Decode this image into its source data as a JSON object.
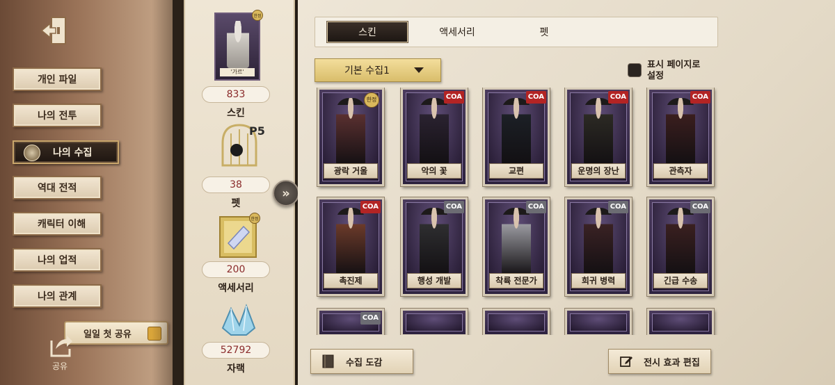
{
  "nav": {
    "items": [
      {
        "label": "개인 파일"
      },
      {
        "label": "나의 전투"
      },
      {
        "label": "나의 수집",
        "active": true
      },
      {
        "label": "역대 전적"
      },
      {
        "label": "캐릭터 이해"
      },
      {
        "label": "나의 업적"
      },
      {
        "label": "나의 관계"
      }
    ],
    "share_pill": "일일 첫 공유",
    "share_label": "공유"
  },
  "stats": {
    "portrait_name": "'가르'",
    "portrait_badge": "한정",
    "skin_count": "833",
    "skin_label": "스킨",
    "pet_count": "38",
    "pet_label": "펫",
    "accessory_count": "200",
    "accessory_label": "액세서리",
    "asset_count": "52792",
    "asset_label": "자랙"
  },
  "tabs": [
    {
      "label": "스킨",
      "active": true
    },
    {
      "label": "액세서리"
    },
    {
      "label": "펫"
    }
  ],
  "filter": {
    "selected": "기본 수집1"
  },
  "display_toggle": {
    "label": "표시 페이지로 설정"
  },
  "cards": [
    {
      "name": "광락 거울",
      "tag": "한정",
      "tag_type": "limited",
      "coat": "#5a3030"
    },
    {
      "name": "악의 꽃",
      "tag": "COA",
      "tag_type": "red",
      "coat": "#2a2230"
    },
    {
      "name": "교편",
      "tag": "COA",
      "tag_type": "red",
      "coat": "#1c2026"
    },
    {
      "name": "운명의 장난",
      "tag": "COA",
      "tag_type": "red",
      "coat": "#2c2a24"
    },
    {
      "name": "관측자",
      "tag": "COA",
      "tag_type": "red",
      "coat": "#3a1e1e"
    },
    {
      "name": "촉진제",
      "tag": "COA",
      "tag_type": "red",
      "coat": "#6b3a2a"
    },
    {
      "name": "행성 개발",
      "tag": "COA",
      "tag_type": "silver",
      "coat": "#2e2e30"
    },
    {
      "name": "착륙 전문가",
      "tag": "COA",
      "tag_type": "silver",
      "coat": "#9a9aa0"
    },
    {
      "name": "희귀 병력",
      "tag": "COA",
      "tag_type": "silver",
      "coat": "#3a2224"
    },
    {
      "name": "긴급 수송",
      "tag": "COA",
      "tag_type": "silver",
      "coat": "#3a2020"
    }
  ],
  "partial_cards": [
    {
      "tag": "COA"
    },
    {},
    {},
    {},
    {}
  ],
  "bottom": {
    "catalog_button": "수집 도감",
    "edit_button": "전시 효과 편집"
  },
  "colors": {
    "accent_gold": "#d9bd6b",
    "coa_red": "#b32424",
    "count_red": "#8a2a2a"
  }
}
